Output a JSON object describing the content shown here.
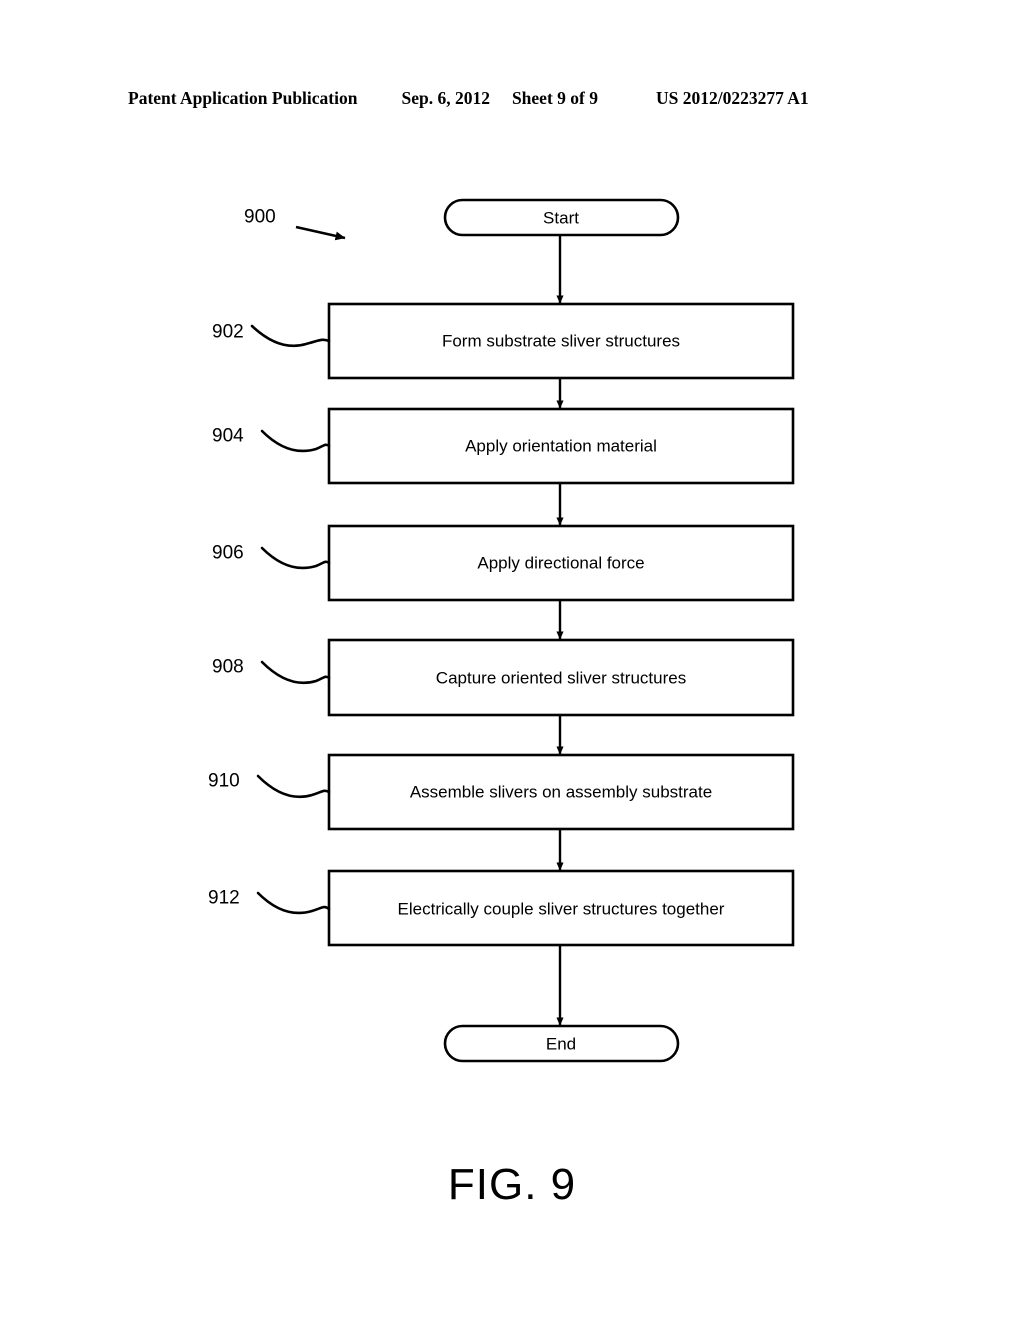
{
  "header": {
    "publication": "Patent Application Publication",
    "date": "Sep. 6, 2012",
    "sheet": "Sheet 9 of 9",
    "patent_number": "US 2012/0223277 A1"
  },
  "figure": {
    "caption": "FIG. 9",
    "diagram_reference": "900",
    "line_color": "#000000",
    "background_color": "#ffffff"
  },
  "flowchart": {
    "type": "flowchart",
    "orientation": "vertical",
    "start_terminator": {
      "label": "Start",
      "shape": "stadium"
    },
    "end_terminator": {
      "label": "End",
      "shape": "stadium"
    },
    "steps": [
      {
        "ref": "902",
        "label": "Form substrate sliver structures"
      },
      {
        "ref": "904",
        "label": "Apply orientation material"
      },
      {
        "ref": "906",
        "label": "Apply directional force"
      },
      {
        "ref": "908",
        "label": "Capture oriented sliver structures"
      },
      {
        "ref": "910",
        "label": "Assemble slivers on assembly substrate"
      },
      {
        "ref": "912",
        "label": "Electrically couple sliver structures together"
      }
    ]
  }
}
